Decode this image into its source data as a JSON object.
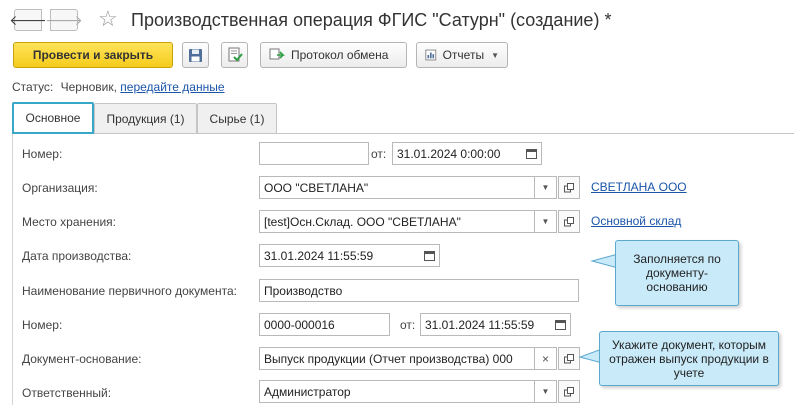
{
  "window": {
    "title": "Производственная операция ФГИС \"Сатурн\" (создание) *"
  },
  "toolbar": {
    "post_close_label": "Провести и закрыть",
    "exchange_label": "Протокол обмена",
    "reports_label": "Отчеты"
  },
  "status": {
    "label": "Статус:",
    "value": "Черновик,",
    "link": "передайте данные"
  },
  "tabs": [
    {
      "label": "Основное",
      "active": true
    },
    {
      "label": "Продукция (1)",
      "active": false
    },
    {
      "label": "Сырье (1)",
      "active": false
    }
  ],
  "form": {
    "number": {
      "label": "Номер:",
      "value": "",
      "date_label": "от:",
      "date_value": "31.01.2024  0:00:00"
    },
    "organization": {
      "label": "Организация:",
      "value": "ООО \"СВЕТЛАНА\"",
      "link": "СВЕТЛАНА ООО"
    },
    "storage": {
      "label": "Место хранения:",
      "value": "[test]Осн.Склад. ООО \"СВЕТЛАНА\"",
      "link": "Основной склад"
    },
    "production_date": {
      "label": "Дата производства:",
      "value": "31.01.2024 11:55:59"
    },
    "primary_doc_name": {
      "label": "Наименование первичного документа:",
      "value": "Производство"
    },
    "primary_doc_number": {
      "label": "Номер:",
      "value": "0000-000016",
      "date_label": "от:",
      "date_value": "31.01.2024 11:55:59"
    },
    "base_doc": {
      "label": "Документ-основание:",
      "value": "Выпуск продукции (Отчет производства) 000"
    },
    "responsible": {
      "label": "Ответственный:",
      "value": "Администратор"
    }
  },
  "callouts": {
    "production_date_hint": "Заполняется по документу-основанию",
    "base_doc_hint": "Укажите документ, которым отражен выпуск продукции в учете"
  },
  "colors": {
    "primary_button": "#f5cc1c",
    "active_tab_border": "#39a7c7",
    "link": "#1a55a8",
    "callout_bg": "#c9eaf9"
  }
}
